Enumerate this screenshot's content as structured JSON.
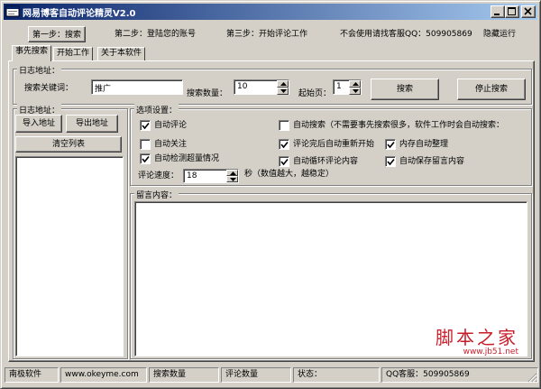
{
  "window": {
    "title": "网易博客自动评论精灵V2.0",
    "accent": "#0a246a"
  },
  "steps": {
    "step1": "第一步：搜索",
    "step2": "第二步：登陆您的账号",
    "step3": "第三步：开始评论工作",
    "contact": "不会使用请找客服QQ：509905869",
    "hide": "隐藏运行"
  },
  "tabs": [
    "事先搜索",
    "开始工作",
    "关于本软件"
  ],
  "search_group": {
    "label": "日志地址：",
    "keyword_label": "搜索关键词：",
    "keyword_value": "推广",
    "count_label": "搜索数量：",
    "count_value": "10",
    "start_label": "起始页：",
    "start_value": "1",
    "search_button": "搜索",
    "stop_button": "停止搜索"
  },
  "address_group": {
    "label": "日志地址：",
    "import_button": "导入地址",
    "export_button": "导出地址",
    "clear_button": "清空列表"
  },
  "options_group": {
    "label": "选项设置：",
    "auto_comment": {
      "label": "自动评论",
      "checked": true
    },
    "auto_search": {
      "label": "自动搜索（不需要事先搜索很多，软件工作时会自动搜索：",
      "checked": false
    },
    "auto_follow": {
      "label": "自动关注",
      "checked": false
    },
    "restart_after": {
      "label": "评论完后自动重新开始",
      "checked": true
    },
    "auto_memory": {
      "label": "内存自动整理",
      "checked": true
    },
    "detect_overflow": {
      "label": "自动检测超量情况",
      "checked": true
    },
    "loop_content": {
      "label": "自动循环评论内容",
      "checked": true
    },
    "save_message": {
      "label": "自动保存留言内容",
      "checked": true
    },
    "speed_label": "评论速度：",
    "speed_value": "18",
    "speed_hint": "秒（数值越大，越稳定）"
  },
  "message_group": {
    "label": "留言内容："
  },
  "status": {
    "company": "南极软件",
    "site": "www.okeyme.com",
    "search_count": "搜索数量",
    "comment_count": "评论数量",
    "state": "状态：",
    "qq": "QQ客服：509905869"
  },
  "watermark": {
    "main": "脚本之家",
    "url": "www.jb51.net"
  }
}
